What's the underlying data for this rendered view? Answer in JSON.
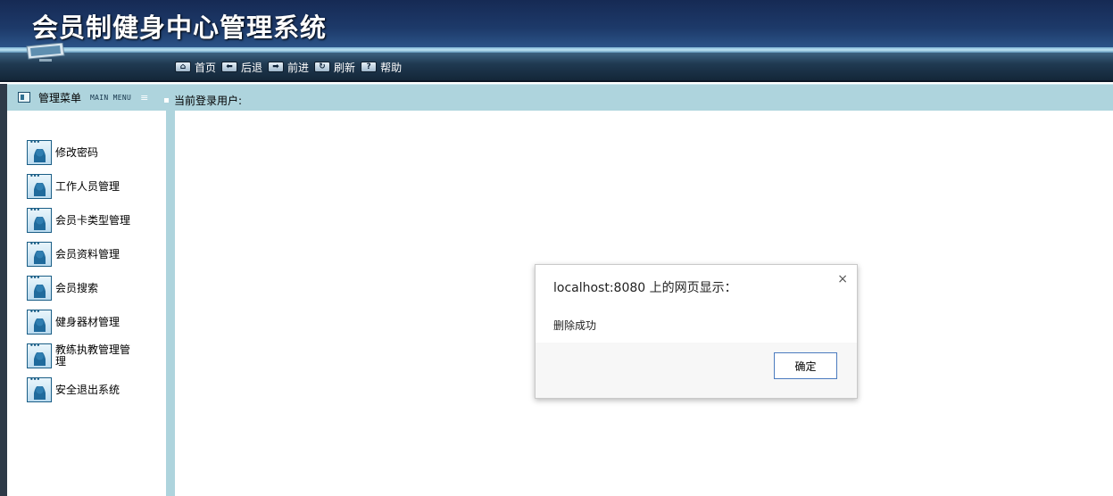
{
  "app": {
    "title": "会员制健身中心管理系统"
  },
  "toolbar": {
    "items": [
      {
        "label": "首页",
        "icon": "home-icon"
      },
      {
        "label": "后退",
        "icon": "arrow-left-icon"
      },
      {
        "label": "前进",
        "icon": "arrow-right-icon"
      },
      {
        "label": "刷新",
        "icon": "refresh-icon"
      },
      {
        "label": "帮助",
        "icon": "help-icon"
      }
    ]
  },
  "menu_header": {
    "title": "管理菜单",
    "subtitle_en": "MAIN MENU"
  },
  "user": {
    "label": "当前登录用户:"
  },
  "sidebar": {
    "items": [
      {
        "label": "修改密码"
      },
      {
        "label": "工作人员管理"
      },
      {
        "label": "会员卡类型管理"
      },
      {
        "label": "会员资料管理"
      },
      {
        "label": "会员搜索"
      },
      {
        "label": "健身器材管理"
      },
      {
        "label": "教练执教管理管理"
      },
      {
        "label": "安全退出系统"
      }
    ]
  },
  "dialog": {
    "title": "localhost:8080 上的网页显示：",
    "message": "删除成功",
    "ok_label": "确定",
    "close_glyph": "×"
  },
  "colors": {
    "header_dark": "#1a2c55",
    "subheader": "#aed4dd",
    "button_border": "#4b7bbf"
  }
}
